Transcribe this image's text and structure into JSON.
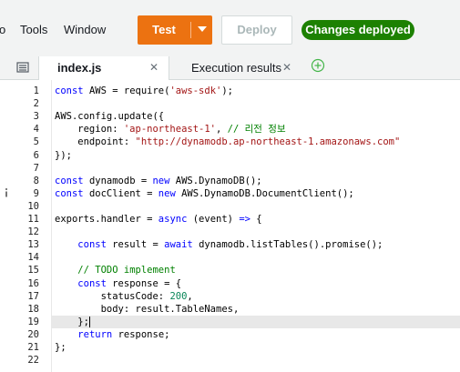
{
  "menu": {
    "items": [
      "o",
      "Tools",
      "Window"
    ]
  },
  "toolbar": {
    "test_label": "Test",
    "deploy_label": "Deploy",
    "status_badge": "Changes deployed",
    "accent_color": "#ec7211",
    "badge_color": "#1d8102"
  },
  "tabs": [
    {
      "label": "index.js",
      "active": true
    },
    {
      "label": "Execution results",
      "active": false
    }
  ],
  "icons": {
    "tab_menu": "panel-menu-icon",
    "close": "close-icon",
    "add_tab": "add-circle-icon",
    "dropdown": "caret-down-icon"
  },
  "editor": {
    "active_line": 19,
    "lines": [
      {
        "n": "1",
        "segs": [
          [
            "kw",
            "const "
          ],
          [
            "ident",
            "AWS = require("
          ],
          [
            "str",
            "'aws-sdk'"
          ],
          [
            "ident",
            ");"
          ]
        ]
      },
      {
        "n": "2",
        "segs": []
      },
      {
        "n": "3",
        "segs": [
          [
            "ident",
            "AWS.config.update({"
          ]
        ]
      },
      {
        "n": "4",
        "segs": [
          [
            "ident",
            "    region: "
          ],
          [
            "str",
            "'ap-northeast-1'"
          ],
          [
            "ident",
            ", "
          ],
          [
            "com",
            "// 리전 정보"
          ]
        ]
      },
      {
        "n": "5",
        "segs": [
          [
            "ident",
            "    endpoint: "
          ],
          [
            "str",
            "\"http://dynamodb.ap-northeast-1.amazonaws.com\""
          ]
        ]
      },
      {
        "n": "6",
        "segs": [
          [
            "ident",
            "});"
          ]
        ]
      },
      {
        "n": "7",
        "segs": []
      },
      {
        "n": "8",
        "segs": [
          [
            "kw",
            "const "
          ],
          [
            "ident",
            "dynamodb = "
          ],
          [
            "kw",
            "new "
          ],
          [
            "ident",
            "AWS.DynamoDB();"
          ]
        ]
      },
      {
        "n": "9",
        "segs": [
          [
            "kw",
            "const "
          ],
          [
            "ident",
            "docClient = "
          ],
          [
            "kw",
            "new "
          ],
          [
            "ident",
            "AWS.DynamoDB.DocumentClient();"
          ]
        ]
      },
      {
        "n": "10",
        "segs": []
      },
      {
        "n": "11",
        "segs": [
          [
            "ident",
            "exports.handler = "
          ],
          [
            "kw",
            "async "
          ],
          [
            "ident",
            "(event) "
          ],
          [
            "kw",
            "=> "
          ],
          [
            "ident",
            "{"
          ]
        ]
      },
      {
        "n": "12",
        "segs": []
      },
      {
        "n": "13",
        "segs": [
          [
            "ident",
            "    "
          ],
          [
            "kw",
            "const "
          ],
          [
            "ident",
            "result = "
          ],
          [
            "kw",
            "await "
          ],
          [
            "ident",
            "dynamodb.listTables().promise();"
          ]
        ]
      },
      {
        "n": "14",
        "segs": []
      },
      {
        "n": "15",
        "segs": [
          [
            "ident",
            "    "
          ],
          [
            "com",
            "// TODO implement"
          ]
        ]
      },
      {
        "n": "16",
        "segs": [
          [
            "ident",
            "    "
          ],
          [
            "kw",
            "const "
          ],
          [
            "ident",
            "response = {"
          ]
        ]
      },
      {
        "n": "17",
        "segs": [
          [
            "ident",
            "        statusCode: "
          ],
          [
            "num",
            "200"
          ],
          [
            "ident",
            ","
          ]
        ]
      },
      {
        "n": "18",
        "segs": [
          [
            "ident",
            "        body: result.TableNames,"
          ]
        ]
      },
      {
        "n": "19",
        "segs": [
          [
            "ident",
            "    };"
          ]
        ]
      },
      {
        "n": "20",
        "segs": [
          [
            "ident",
            "    "
          ],
          [
            "kw",
            "return "
          ],
          [
            "ident",
            "response;"
          ]
        ]
      },
      {
        "n": "21",
        "segs": [
          [
            "ident",
            "};"
          ]
        ]
      },
      {
        "n": "22",
        "segs": []
      }
    ]
  }
}
